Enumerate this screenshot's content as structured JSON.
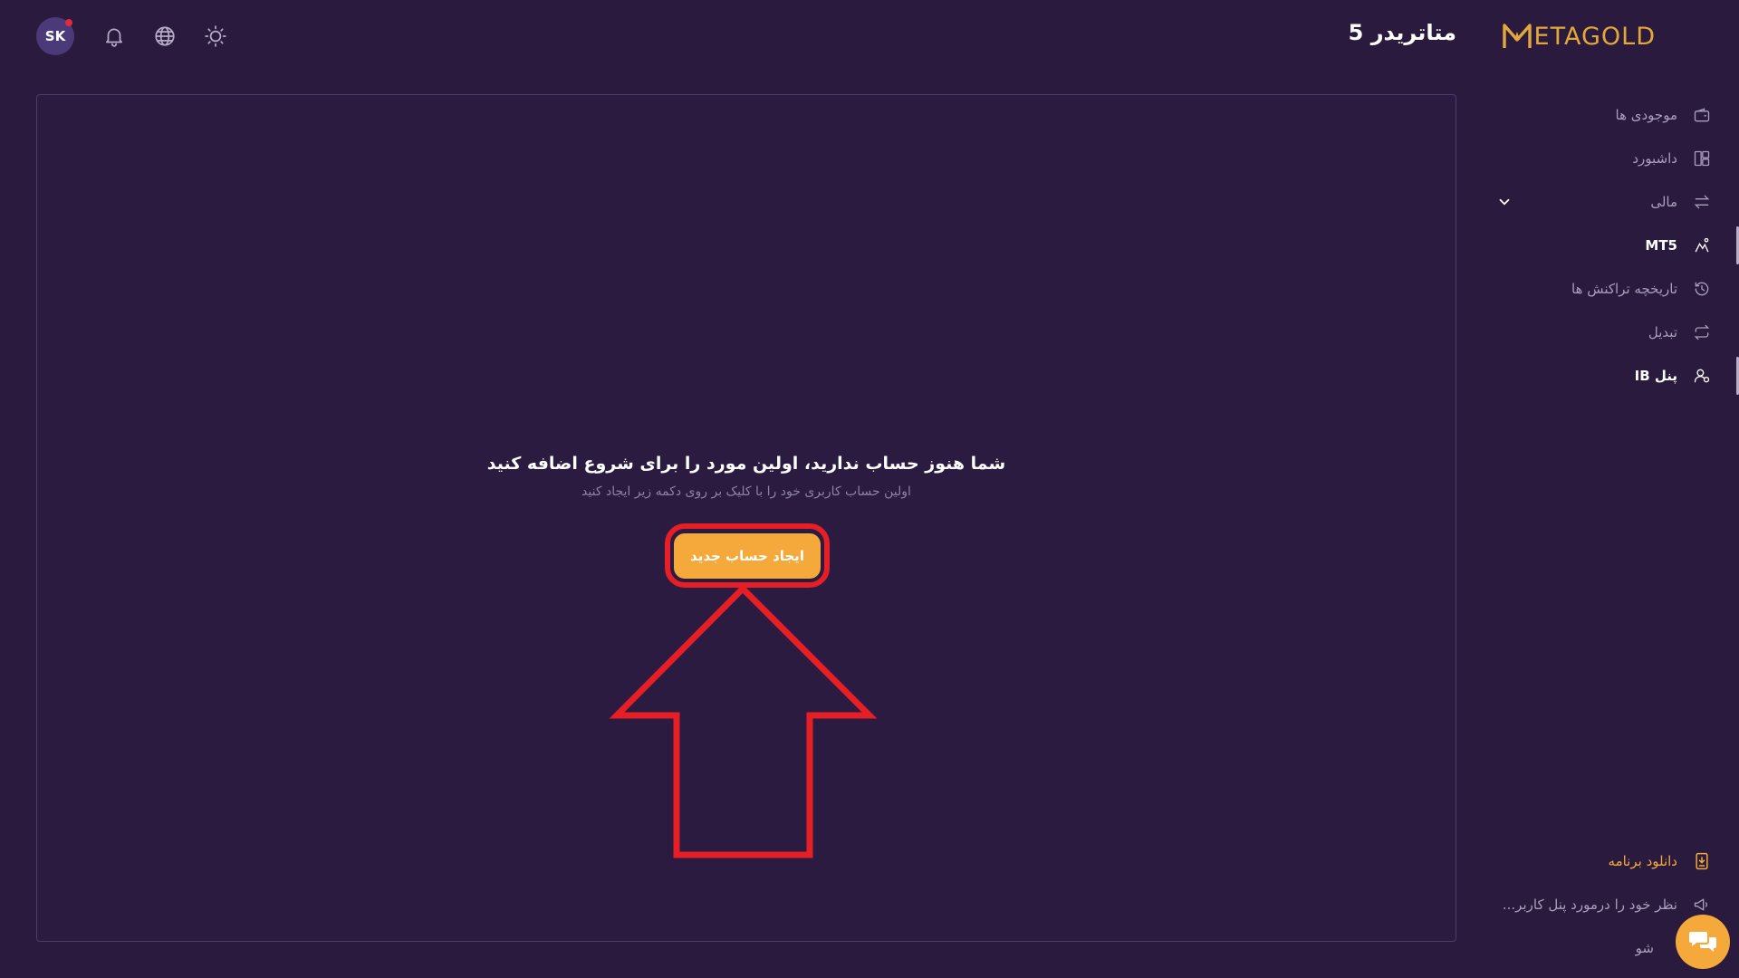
{
  "header": {
    "avatar_initials": "SK",
    "page_title": "متاتریدر 5",
    "logo_text": "ETAGOLD",
    "logo_letter": "M"
  },
  "main": {
    "empty_title": "شما هنوز حساب ندارید، اولین مورد را برای شروع اضافه کنید",
    "empty_subtitle": "اولین حساب کاربری خود را با کلیک بر روی دکمه زیر ایجاد کنید",
    "create_button": "ایجاد حساب جدید"
  },
  "sidebar": {
    "items": [
      {
        "label": "موجودی ها",
        "icon": "wallet-icon"
      },
      {
        "label": "داشبورد",
        "icon": "dashboard-icon"
      },
      {
        "label": "مالی",
        "icon": "transfer-icon",
        "expandable": true
      },
      {
        "label": "MT5",
        "icon": "mt5-icon",
        "active": true
      },
      {
        "label": "تاریخچه تراکنش ها",
        "icon": "history-icon"
      },
      {
        "label": "تبدیل",
        "icon": "convert-icon"
      },
      {
        "label": "پنل IB",
        "icon": "ib-panel-icon",
        "active": true
      }
    ],
    "bottom": [
      {
        "label": "دانلود برنامه",
        "icon": "download-app-icon"
      },
      {
        "label": "نظر خود را درمورد پنل کاربر...",
        "icon": "feedback-icon"
      },
      {
        "label": "شو",
        "icon": "logout-icon"
      }
    ]
  },
  "colors": {
    "background": "#2a1a3d",
    "accent": "#f5a93a",
    "annotation": "#e61e25",
    "logo": "#e2a93a"
  }
}
